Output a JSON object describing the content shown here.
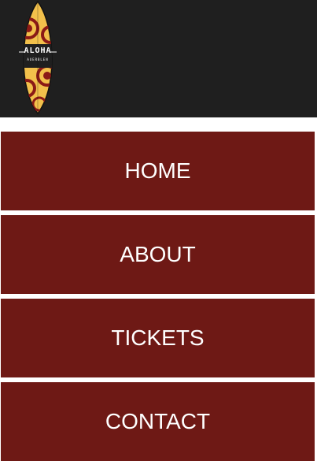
{
  "header": {
    "logo": {
      "text": "ALOHA",
      "subtext": "AUERBLEN"
    },
    "logo_icon": "surfboard-logo-icon"
  },
  "nav": {
    "items": [
      {
        "label": "HOME"
      },
      {
        "label": "ABOUT"
      },
      {
        "label": "TICKETS"
      },
      {
        "label": "CONTACT"
      }
    ]
  },
  "colors": {
    "header_bg": "#1f1f1f",
    "nav_bg": "#6e1915",
    "nav_text": "#ffffff",
    "board_yellow": "#f2c04b",
    "board_red": "#8b1a16"
  }
}
